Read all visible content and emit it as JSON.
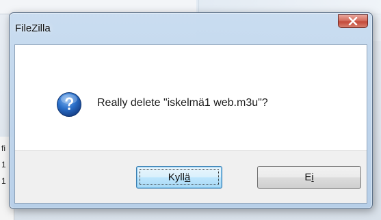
{
  "background": {
    "left_column_fragments": [
      "fi",
      "1",
      "1"
    ]
  },
  "dialog": {
    "title": "FileZilla",
    "message": "Really delete \"iskelmä1 web.m3u\"?",
    "icon": "question-icon",
    "buttons": {
      "yes": {
        "prefix": "Kyll",
        "mnemonic": "ä",
        "suffix": ""
      },
      "no": {
        "prefix": "E",
        "mnemonic": "i",
        "suffix": ""
      }
    }
  },
  "colors": {
    "title_glass": "#c8dcf0",
    "close_button": "#c44a3a",
    "default_button_border": "#3c7fb1",
    "question_icon": "#1f5fb8"
  }
}
